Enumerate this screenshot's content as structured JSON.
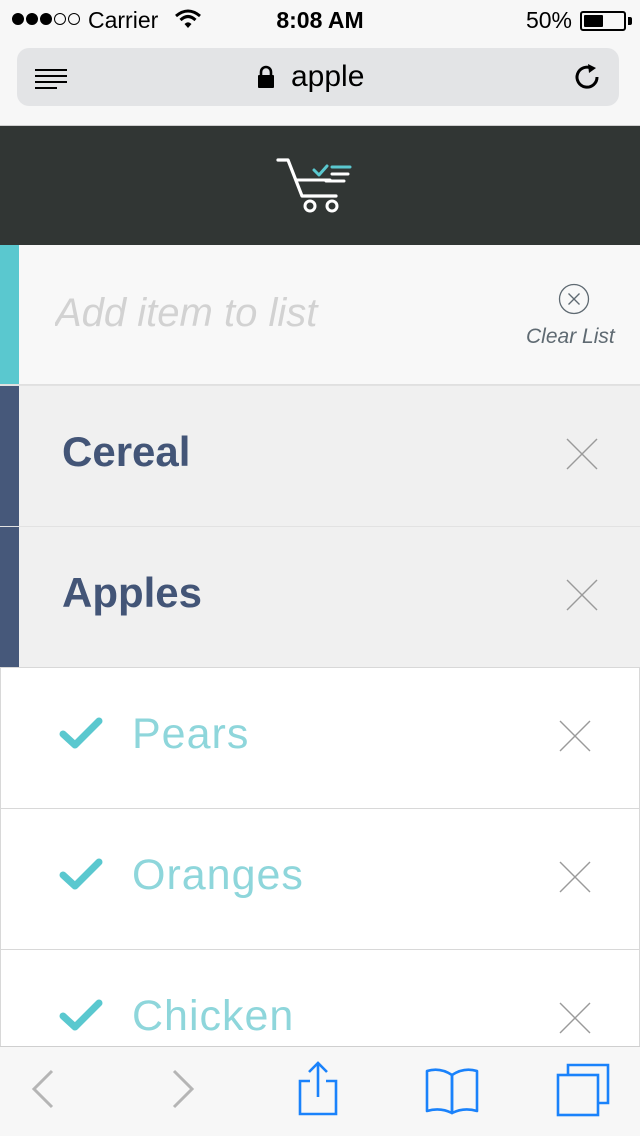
{
  "status": {
    "carrier": "Carrier",
    "time": "8:08 AM",
    "battery": "50%",
    "battery_level": 0.5
  },
  "browser": {
    "url": "apple",
    "reader_icon": "reader-icon",
    "reload_icon": "reload-icon",
    "lock_icon": "lock-icon"
  },
  "app": {
    "logo_icon": "shopping-cart-list-icon",
    "accent_teal": "#5ac8cf",
    "accent_navy": "#46587a",
    "header_bg": "#313634"
  },
  "add": {
    "placeholder": "Add item to list",
    "clear_label": "Clear List"
  },
  "items": [
    {
      "label": "Cereal",
      "checked": false
    },
    {
      "label": "Apples",
      "checked": false
    },
    {
      "label": "Pears",
      "checked": true
    },
    {
      "label": "Oranges",
      "checked": true
    },
    {
      "label": "Chicken",
      "checked": true
    }
  ],
  "toolbar": {
    "buttons": [
      "back-icon",
      "forward-icon",
      "share-icon",
      "bookmarks-icon",
      "tabs-icon"
    ],
    "accent": "#1a82fb"
  }
}
